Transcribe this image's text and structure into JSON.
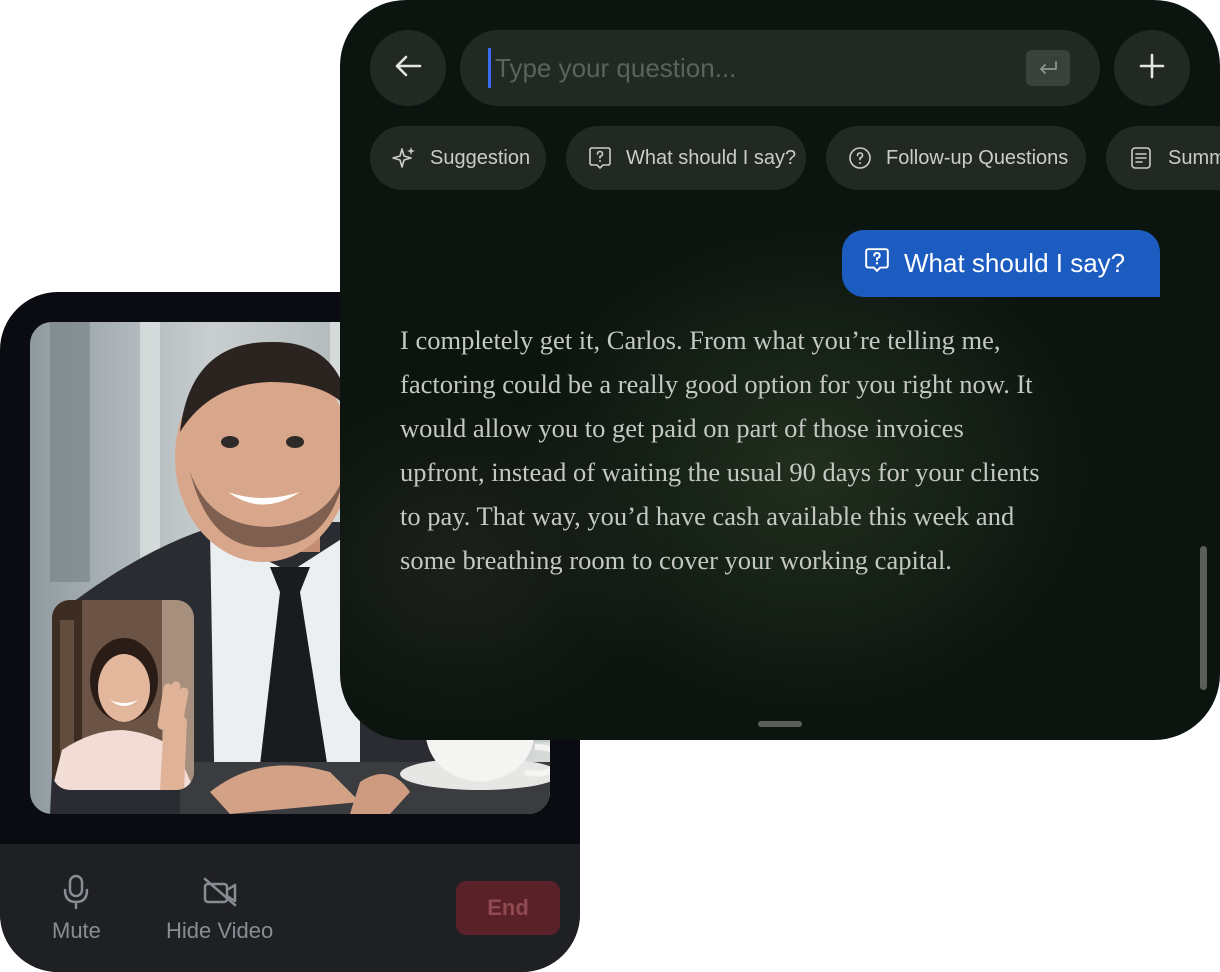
{
  "call": {
    "controls": {
      "mute_label": "Mute",
      "hide_video_label": "Hide Video",
      "end_label": "End"
    },
    "colors": {
      "end_button": "#5a2129",
      "controls_bg": "#1f2024"
    }
  },
  "assistant": {
    "search": {
      "placeholder": "Type your question..."
    },
    "chips": [
      {
        "label": "Suggestion",
        "icon": "sparkles-icon"
      },
      {
        "label": "What should I say?",
        "icon": "question-bubble-icon"
      },
      {
        "label": "Follow-up Questions",
        "icon": "question-circle-icon"
      },
      {
        "label": "Summ",
        "icon": "document-icon"
      }
    ],
    "user_message": {
      "text": "What should I say?",
      "icon": "question-bubble-icon"
    },
    "reply": "I completely get it, Carlos. From what you’re telling me, factoring could be a really good option for you right now. It would allow you to get paid on part of those invoices upfront, instead of waiting the usual 90 days for your clients to pay. That way, you’d have cash available this week and some breathing room to cover your working capital.",
    "colors": {
      "accent": "#1c5bbf",
      "caret": "#3b6cf0",
      "panel_bg": "#0b140f"
    }
  }
}
